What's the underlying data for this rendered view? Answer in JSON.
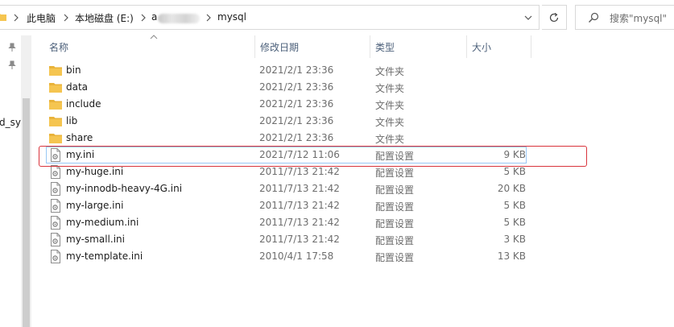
{
  "address": {
    "crumbs": [
      "此电脑",
      "本地磁盘 (E:)",
      "a",
      "mysql"
    ]
  },
  "search": {
    "placeholder": "搜索\"mysql\""
  },
  "nav": {
    "partial_label": "d_sy"
  },
  "columns": {
    "name": "名称",
    "modified": "修改日期",
    "type": "类型",
    "size": "大小"
  },
  "files": [
    {
      "name": "bin",
      "modified": "2021/2/1 23:36",
      "type": "文件夹",
      "size": "",
      "icon": "folder-icon"
    },
    {
      "name": "data",
      "modified": "2021/2/1 23:36",
      "type": "文件夹",
      "size": "",
      "icon": "folder-icon"
    },
    {
      "name": "include",
      "modified": "2021/2/1 23:36",
      "type": "文件夹",
      "size": "",
      "icon": "folder-icon"
    },
    {
      "name": "lib",
      "modified": "2021/2/1 23:36",
      "type": "文件夹",
      "size": "",
      "icon": "folder-icon"
    },
    {
      "name": "share",
      "modified": "2021/2/1 23:36",
      "type": "文件夹",
      "size": "",
      "icon": "folder-icon"
    },
    {
      "name": "my.ini",
      "modified": "2021/7/12 11:06",
      "type": "配置设置",
      "size": "9 KB",
      "icon": "config-file-icon"
    },
    {
      "name": "my-huge.ini",
      "modified": "2011/7/13 21:42",
      "type": "配置设置",
      "size": "5 KB",
      "icon": "config-file-icon"
    },
    {
      "name": "my-innodb-heavy-4G.ini",
      "modified": "2011/7/13 21:42",
      "type": "配置设置",
      "size": "20 KB",
      "icon": "config-file-icon"
    },
    {
      "name": "my-large.ini",
      "modified": "2011/7/13 21:42",
      "type": "配置设置",
      "size": "5 KB",
      "icon": "config-file-icon"
    },
    {
      "name": "my-medium.ini",
      "modified": "2011/7/13 21:42",
      "type": "配置设置",
      "size": "5 KB",
      "icon": "config-file-icon"
    },
    {
      "name": "my-small.ini",
      "modified": "2011/7/13 21:42",
      "type": "配置设置",
      "size": "3 KB",
      "icon": "config-file-icon"
    },
    {
      "name": "my-template.ini",
      "modified": "2010/4/1 17:58",
      "type": "配置设置",
      "size": "13 KB",
      "icon": "config-file-icon"
    }
  ],
  "colors": {
    "highlight": "#d9343c",
    "focus_outline": "#99c7f5",
    "folder": "#f5c550",
    "header_text": "#4c607a"
  }
}
